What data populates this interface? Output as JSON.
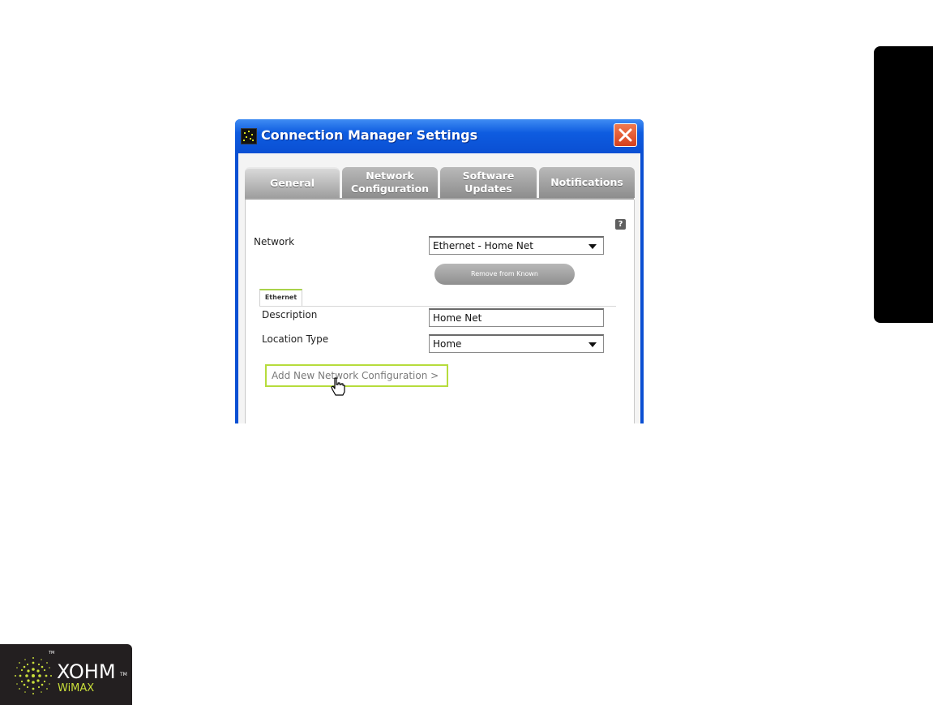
{
  "window": {
    "title": "Connection Manager Settings"
  },
  "tabs": [
    {
      "label": "General",
      "active": true
    },
    {
      "label": "Network\nConfiguration",
      "active": false
    },
    {
      "label": "Software\nUpdates",
      "active": false
    },
    {
      "label": "Notifications",
      "active": false
    }
  ],
  "help": {
    "label": "?"
  },
  "network": {
    "label": "Network",
    "selected": "Ethernet - Home Net",
    "remove_button": "Remove from Known"
  },
  "subtab": {
    "label": "Ethernet"
  },
  "description": {
    "label": "Description",
    "value": "Home Net"
  },
  "location_type": {
    "label": "Location Type",
    "selected": "Home"
  },
  "add_link": {
    "label": "Add New Network Configuration >"
  },
  "logo": {
    "word": "XOHM",
    "sub": "WiMAX",
    "tm": "TM",
    "tm_small": "TM"
  },
  "colors": {
    "titlebar": "#0a4fd3",
    "tab": "#9e9e9e",
    "accent_green": "#b6dc3c",
    "close": "#d6401e"
  },
  "icons": [
    "app-icon",
    "close-icon",
    "help-icon",
    "dropdown-arrow-icon",
    "hand-cursor-icon",
    "xohm-logo-icon"
  ]
}
